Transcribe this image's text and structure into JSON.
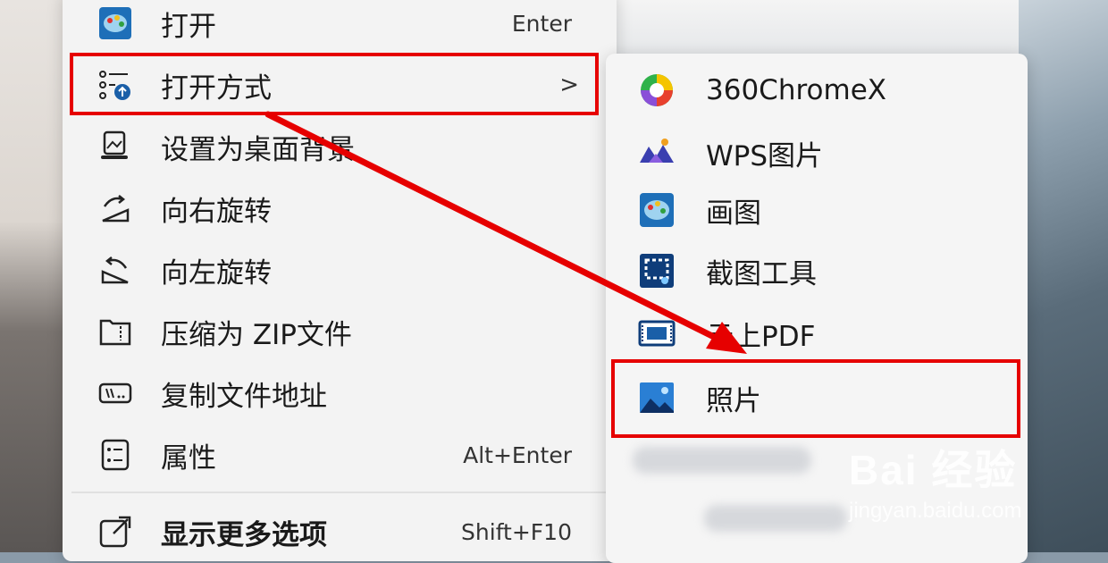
{
  "context_menu": {
    "items": [
      {
        "label": "打开",
        "shortcut": "Enter",
        "icon": "paint-icon"
      },
      {
        "label": "打开方式",
        "icon": "open-with-icon"
      },
      {
        "label": "设置为桌面背景",
        "icon": "wallpaper-icon"
      },
      {
        "label": "向右旋转",
        "icon": "rotate-right-icon"
      },
      {
        "label": "向左旋转",
        "icon": "rotate-left-icon"
      },
      {
        "label": "压缩为 ZIP文件",
        "icon": "zip-icon"
      },
      {
        "label": "复制文件地址",
        "icon": "copy-path-icon"
      },
      {
        "label": "属性",
        "shortcut": "Alt+Enter",
        "icon": "properties-icon"
      },
      {
        "label": "显示更多选项",
        "shortcut": "Shift+F10",
        "icon": "more-options-icon"
      }
    ],
    "submenu_chevron": ">"
  },
  "open_with_submenu": {
    "items": [
      {
        "label": "360ChromeX",
        "icon": "chrome360-icon"
      },
      {
        "label": "WPS图片",
        "icon": "wps-pictures-icon"
      },
      {
        "label": "画图",
        "icon": "paint-icon"
      },
      {
        "label": "截图工具",
        "icon": "snipping-tool-icon"
      },
      {
        "label": "云上PDF",
        "icon": "pdf-icon"
      },
      {
        "label": "照片",
        "icon": "photos-icon"
      }
    ]
  },
  "annotation": {
    "box_color": "#e60000",
    "arrow_color": "#e60000"
  },
  "watermark": {
    "brand": "Bai 经验",
    "url": "jingyan.baidu.com"
  }
}
